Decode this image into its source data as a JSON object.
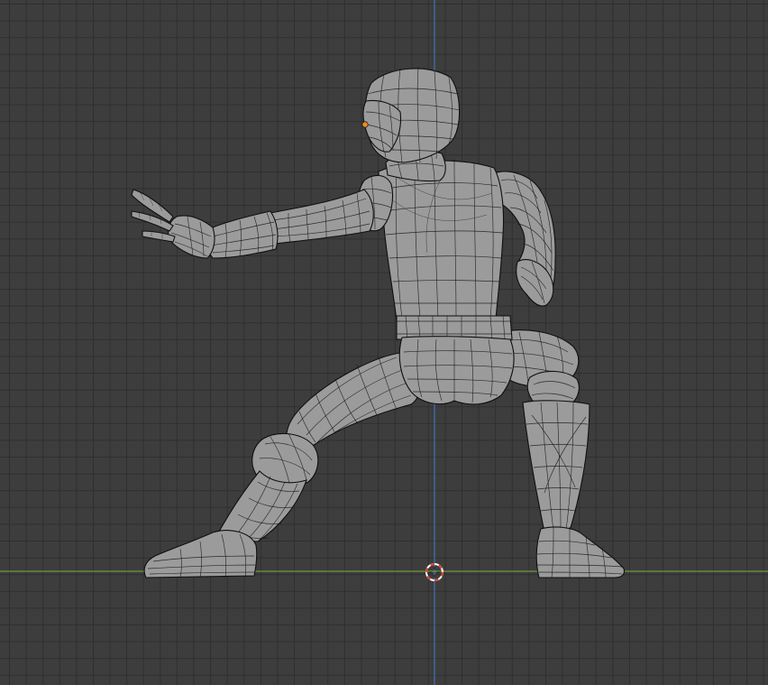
{
  "viewport": {
    "background": "#3d3d3d",
    "grid_minor_color": "#2f2f2f",
    "axis_z_color": "#3f6fb3",
    "axis_y_color": "#6d9b3c",
    "mesh_color": "#9b9b9b",
    "wire_color": "#161616",
    "cursor_colors": [
      "#e0402d",
      "#ffffff"
    ],
    "origin_color": "#f08a1c"
  },
  "icons": {
    "cursor": "3d-cursor-icon",
    "origin": "object-origin-icon"
  }
}
